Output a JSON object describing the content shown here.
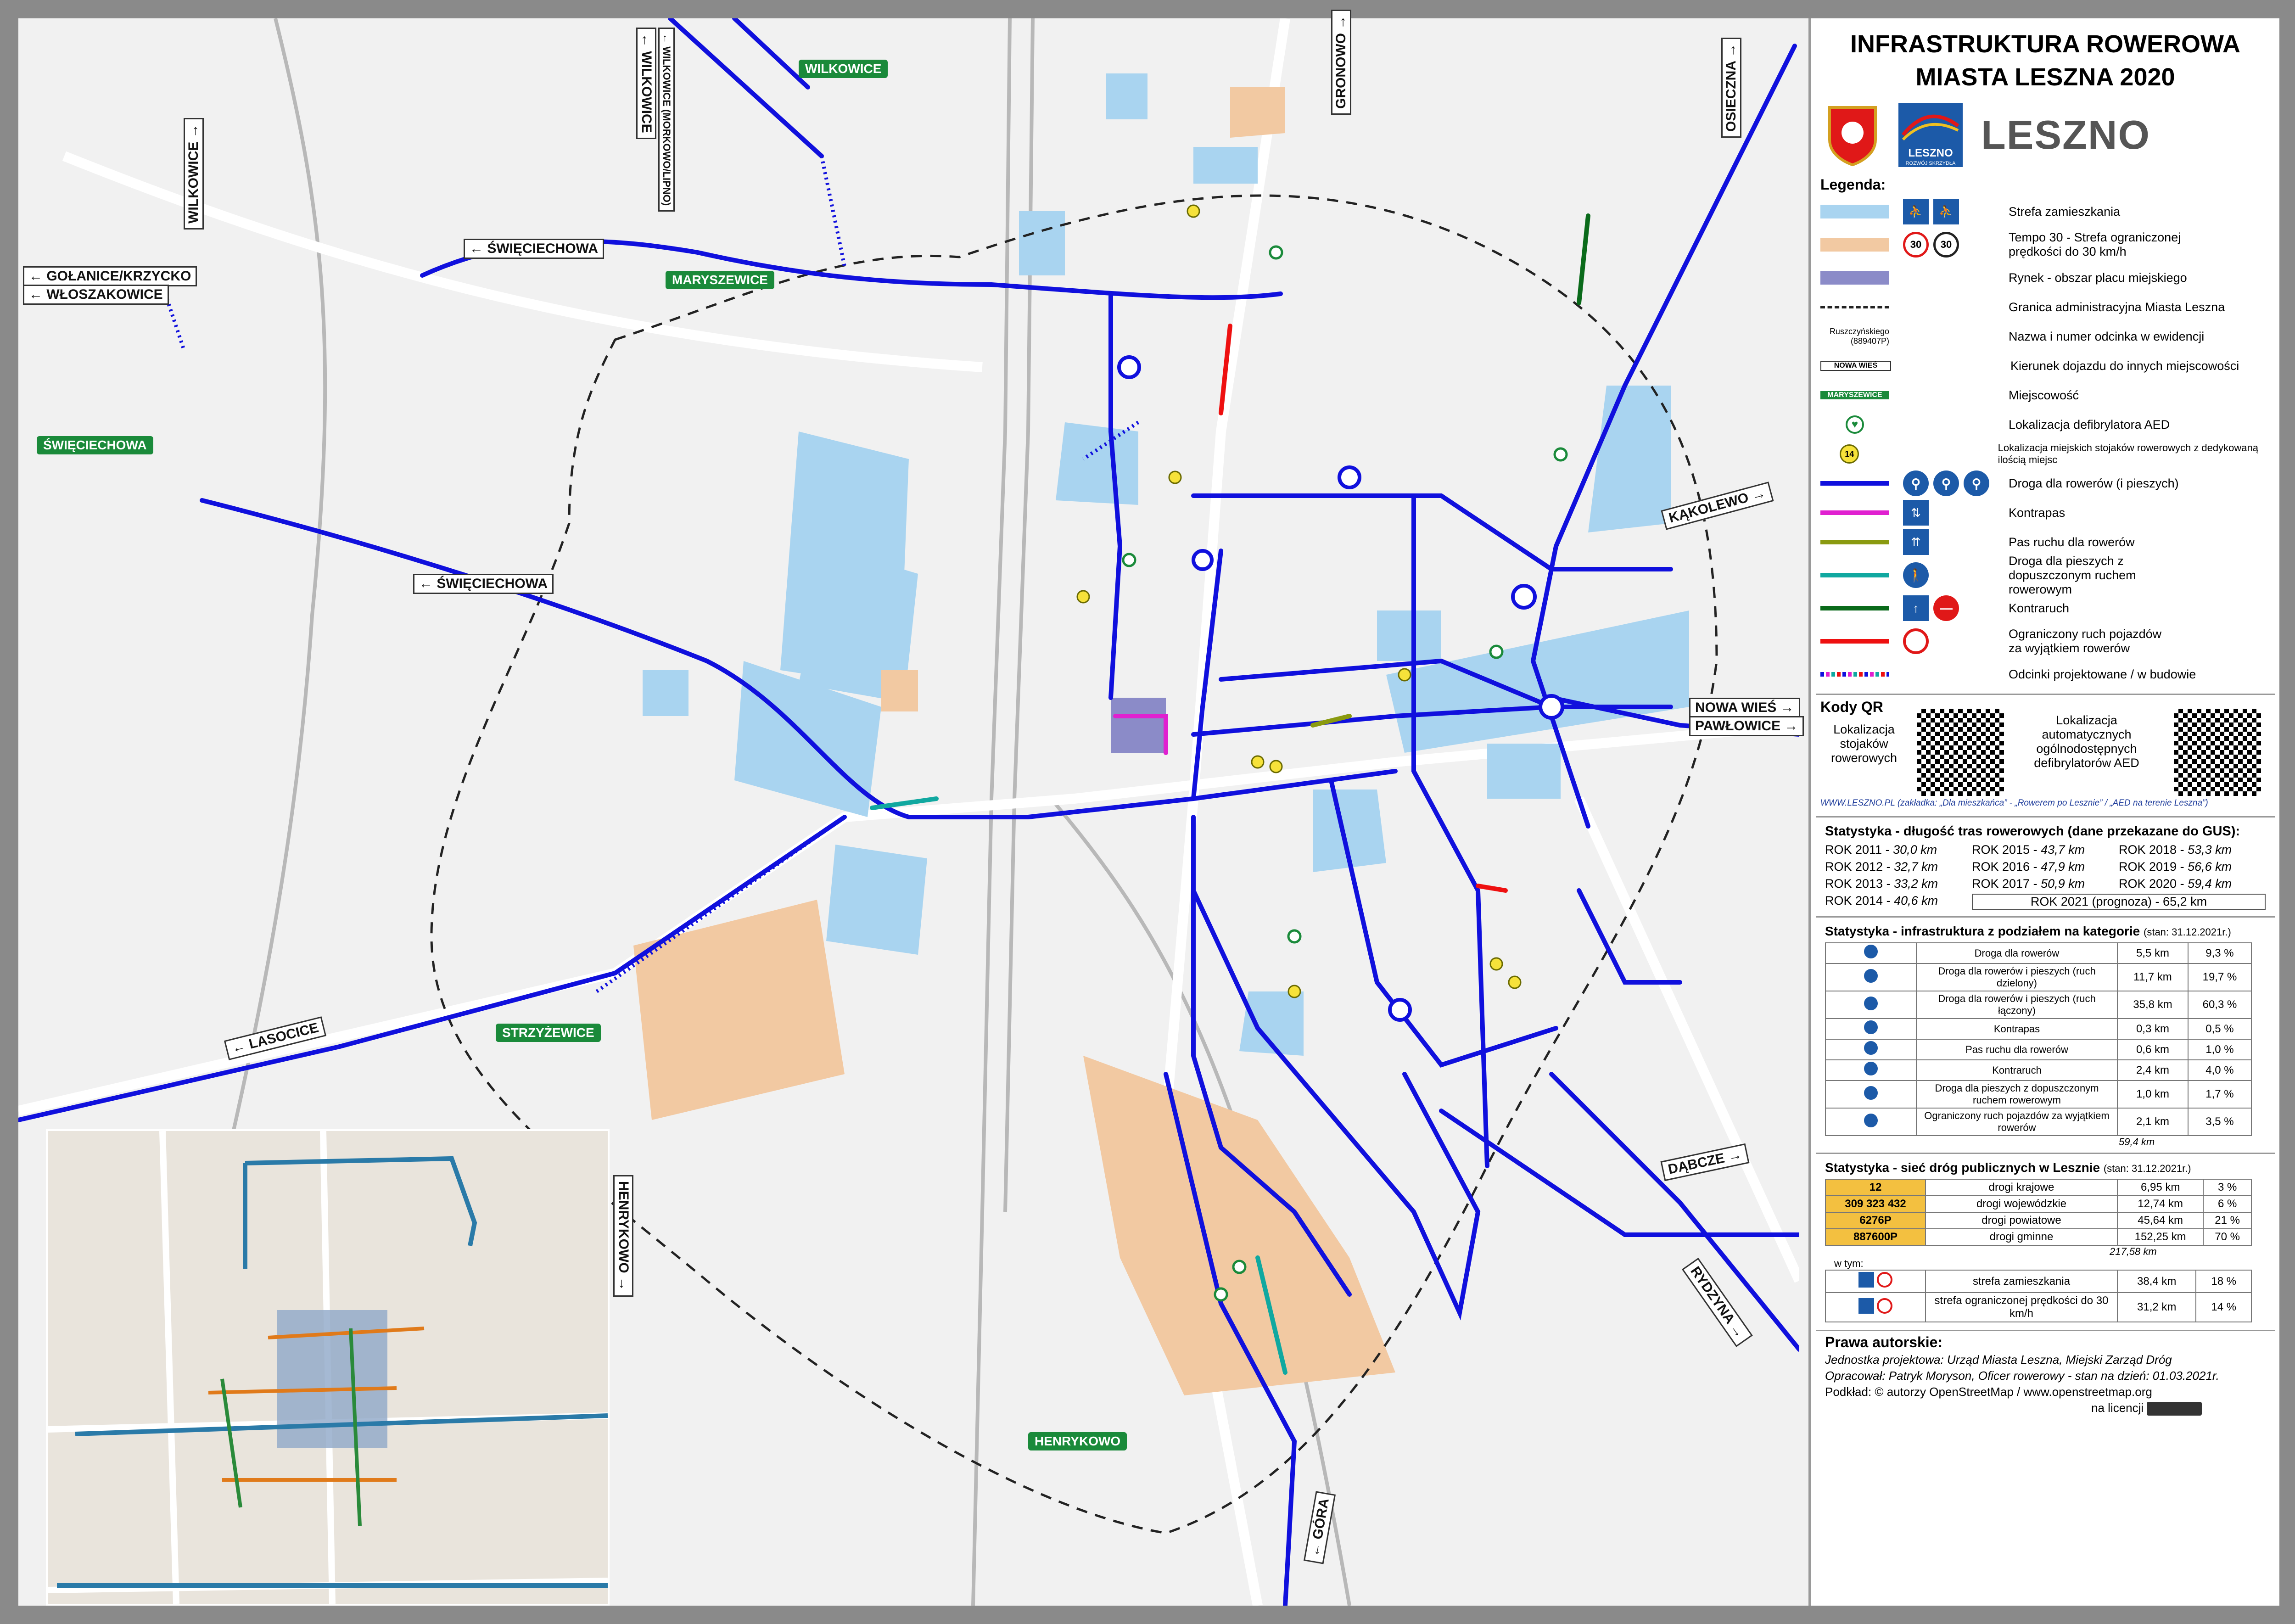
{
  "header": {
    "title_line1": "INFRASTRUKTURA ROWEROWA",
    "title_line2": "MIASTA LESZNA 2020",
    "logo_text": "LESZNO",
    "logo_sub": "LESZNO",
    "logo_sub2": "ROZWÓJ SKRZYDŁA"
  },
  "legend": {
    "heading": "Legenda:",
    "items": [
      {
        "label": "Strefa zamieszkania",
        "color": "#a9d4f0"
      },
      {
        "label": "Tempo 30 - Strefa ograniczonej prędkości do 30 km/h",
        "color": "#f2c9a2"
      },
      {
        "label": "Rynek - obszar placu miejskiego",
        "color": "#8b8bc8"
      },
      {
        "label": "Granica administracyjna Miasta Leszna"
      },
      {
        "label": "Nazwa i numer odcinka w ewidencji",
        "sample1": "Ruszczyńskiego",
        "sample2": "(889407P)"
      },
      {
        "label": "Kierunek dojazdu do innych miejscowości",
        "sample": "NOWA WIEŚ"
      },
      {
        "label": "Miejscowość",
        "sample": "MARYSZEWICE"
      },
      {
        "label": "Lokalizacja defibrylatora AED"
      },
      {
        "label": "Lokalizacja miejskich stojaków rowerowych z dedykowaną ilością miejsc",
        "sample": "14"
      },
      {
        "label": "Droga dla rowerów (i pieszych)",
        "color": "#1010dd"
      },
      {
        "label": "Kontrapas",
        "color": "#e020d0"
      },
      {
        "label": "Pas ruchu dla rowerów",
        "color": "#8a9a10"
      },
      {
        "label": "Droga dla pieszych z dopuszczonym ruchem rowerowym",
        "color": "#10a8a0"
      },
      {
        "label": "Kontraruch",
        "color": "#0a6a1a"
      },
      {
        "label": "Ograniczony ruch pojazdów za wyjątkiem rowerów",
        "color": "#ee1010"
      },
      {
        "label": "Odcinki projektowane / w budowie"
      }
    ],
    "speed_sign": "30"
  },
  "qr": {
    "heading": "Kody QR",
    "left_label": "Lokalizacja stojaków rowerowych",
    "right_label": "Lokalizacja automatycznych ogólnodostępnych defibrylatorów AED",
    "link": "WWW.LESZNO.PL (zakładka: „Dla mieszkańca” - „Rowerem po Lesznie” / „AED na terenie Leszna”)"
  },
  "stats_length": {
    "heading": "Statystyka - długość tras rowerowych (dane przekazane do GUS):",
    "years": [
      {
        "y": "ROK 2011 -",
        "v": "30,0 km"
      },
      {
        "y": "ROK 2012 -",
        "v": "32,7 km"
      },
      {
        "y": "ROK 2013 -",
        "v": "33,2 km"
      },
      {
        "y": "ROK 2014 -",
        "v": "40,6 km"
      },
      {
        "y": "ROK 2015 -",
        "v": "43,7 km"
      },
      {
        "y": "ROK 2016 -",
        "v": "47,9 km"
      },
      {
        "y": "ROK 2017 -",
        "v": "50,9 km"
      },
      {
        "y": "ROK 2018 -",
        "v": "53,3 km"
      },
      {
        "y": "ROK 2019 -",
        "v": "56,6 km"
      },
      {
        "y": "ROK 2020 -",
        "v": "59,4 km"
      }
    ],
    "forecast": "ROK 2021 (prognoza) - 65,2 km"
  },
  "stats_categories": {
    "heading": "Statystyka - infrastruktura z podziałem na kategorie",
    "date": "(stan: 31.12.2021r.)",
    "rows": [
      {
        "name": "Droga dla rowerów",
        "km": "5,5 km",
        "pct": "9,3 %"
      },
      {
        "name": "Droga dla rowerów i pieszych (ruch dzielony)",
        "km": "11,7 km",
        "pct": "19,7 %"
      },
      {
        "name": "Droga dla rowerów i pieszych (ruch łączony)",
        "km": "35,8 km",
        "pct": "60,3 %"
      },
      {
        "name": "Kontrapas",
        "km": "0,3 km",
        "pct": "0,5 %"
      },
      {
        "name": "Pas ruchu dla rowerów",
        "km": "0,6 km",
        "pct": "1,0 %"
      },
      {
        "name": "Kontraruch",
        "km": "2,4 km",
        "pct": "4,0 %"
      },
      {
        "name": "Droga dla pieszych z dopuszczonym ruchem rowerowym",
        "km": "1,0 km",
        "pct": "1,7 %"
      },
      {
        "name": "Ograniczony ruch pojazdów za wyjątkiem rowerów",
        "km": "2,1 km",
        "pct": "3,5 %"
      }
    ],
    "total": "59,4 km"
  },
  "stats_roads": {
    "heading": "Statystyka - sieć dróg publicznych w Lesznie",
    "date": "(stan: 31.12.2021r.)",
    "rows": [
      {
        "codes": "12",
        "name": "drogi krajowe",
        "km": "6,95 km",
        "pct": "3 %"
      },
      {
        "codes": "309 323 432",
        "name": "drogi wojewódzkie",
        "km": "12,74 km",
        "pct": "6 %"
      },
      {
        "codes": "6276P",
        "name": "drogi powiatowe",
        "km": "45,64 km",
        "pct": "21 %"
      },
      {
        "codes": "887600P",
        "name": "drogi gminne",
        "km": "152,25 km",
        "pct": "70 %"
      }
    ],
    "total": "217,58 km",
    "sub_heading": "w tym:",
    "sub_rows": [
      {
        "name": "strefa zamieszkania",
        "km": "38,4 km",
        "pct": "18 %"
      },
      {
        "name": "strefa ograniczonej prędkości do 30 km/h",
        "km": "31,2 km",
        "pct": "14 %"
      }
    ]
  },
  "copyright": {
    "heading": "Prawa autorskie:",
    "line1": "Jednostka projektowa: Urząd Miasta Leszna, Miejski Zarząd Dróg",
    "line2": "Opracował: Patryk Moryson, Oficer rowerowy - stan na dzień: 01.03.2021r.",
    "line3": "Podkład: © autorzy OpenStreetMap / www.openstreetmap.org",
    "line4": "na licencji"
  },
  "map_labels": {
    "directions": [
      {
        "text": "← WILKOWICE"
      },
      {
        "text": "← WILKOWICE (MORKOWO/LIPNO)"
      },
      {
        "text": "GRONOWO →"
      },
      {
        "text": "OSIECZNA →"
      },
      {
        "text": "WILKOWICE →"
      },
      {
        "text": "← GOŁANICE/KRZYCKO"
      },
      {
        "text": "← WŁOSZAKOWICE"
      },
      {
        "text": "← ŚWIĘCIECHOWA"
      },
      {
        "text": "← ŚWIĘCIECHOWA"
      },
      {
        "text": "KĄKOLEWO →"
      },
      {
        "text": "NOWA WIEŚ →"
      },
      {
        "text": "PAWŁOWICE →"
      },
      {
        "text": "← LASOCICE"
      },
      {
        "text": "HENRYKOWO →"
      },
      {
        "text": "DĄBCZE →"
      },
      {
        "text": "RYDZYNA →"
      },
      {
        "text": "← GÓRA"
      }
    ],
    "places": [
      {
        "text": "WILKOWICE"
      },
      {
        "text": "MARYSZEWICE"
      },
      {
        "text": "ŚWIĘCIECHOWA"
      },
      {
        "text": "STRZYŻEWICE"
      },
      {
        "text": "HENRYKOWO"
      }
    ]
  }
}
